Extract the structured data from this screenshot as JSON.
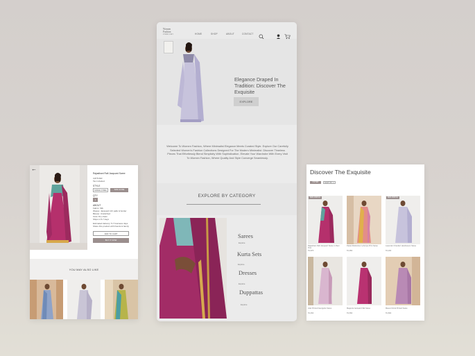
{
  "product_detail": {
    "back_icon": "arrow-left-icon",
    "product_title": "Rajasthani Rafi Jacquard Saree",
    "price": "3,875 INR",
    "price_note": "Tax included.",
    "style_label": "STYLE",
    "size_value": "SAREE (FREE)",
    "size_guide_label": "SIZE GUIDE",
    "qty_label": "QTY",
    "qty_value": "1",
    "about_label": "ABOUT",
    "about_lines": [
      "Fabric: Silk",
      "Weave: Jacquard rich pallu & border",
      "Blouse: Unstitched",
      "Care: Dry clean",
      "Ships in 5-7 days"
    ],
    "delivery_note": "Estimated delivery: 5-7 business days",
    "share_note": "Share this product with friends & family",
    "add_to_cart": "ADD TO CART",
    "buy_it_now": "BUY IT NOW",
    "you_may_also_like": "YOU MAY ALSO LIKE"
  },
  "home": {
    "logo_line1": "Women",
    "logo_line2": "Fashion",
    "logo_line3": "ETHNIC EDIT",
    "nav": [
      "HOME",
      "SHOP",
      "ABOUT",
      "CONTACT"
    ],
    "icons": [
      "search-icon",
      "user-icon",
      "cart-icon"
    ],
    "hero_title": "Elegance Draped In Tradition: Discover The Exquisite",
    "explore_label": "EXPLORE",
    "welcome_text": "Welcome To Women Fashion, Where Minimalist Elegance Meets Curated Style. Explore Our Carefully Selected Women's Fashion Collections Designed For The Modern Minimalist. Discover Timeless Pieces That Effortlessly Blend Simplicity With Sophistication. Elevate Your Wardrobe With Every Visit To Women Fashion, Where Quality And Style Converge Seamlessly.",
    "category_title": "EXPLORE BY CATEGORY",
    "categories": [
      {
        "name": "Sarees",
        "sub": "Explore"
      },
      {
        "name": "Kurta Sets",
        "sub": "Explore"
      },
      {
        "name": "Dresses",
        "sub": "Explore"
      },
      {
        "name": "Duppattas",
        "sub": "Explore"
      }
    ]
  },
  "collection": {
    "title": "Discover The  Exquisite",
    "filters": [
      "FILTER",
      "SORT BY ✕"
    ],
    "badge": "NEW ARRIVAL",
    "items": [
      {
        "caption": "Rajasthani Rafi Jacquard Saree in Rani Pink",
        "price": "₹3,875"
      },
      {
        "caption": "Pastel Multicolour Leheriya Print Saree",
        "price": "₹2,950"
      },
      {
        "caption": "Lavender Chanderi Handwoven Saree",
        "price": "₹4,200"
      },
      {
        "caption": "Lilac Printed Georgette Saree",
        "price": "₹2,450"
      },
      {
        "caption": "Magenta Jacquard Silk Saree",
        "price": "₹3,650"
      },
      {
        "caption": "Mauve Floral Printed Saree",
        "price": "₹2,800"
      }
    ]
  },
  "colors": {
    "accent": "#9b8f8e",
    "magenta": "#b0336f",
    "background": "#d6d1cd"
  }
}
